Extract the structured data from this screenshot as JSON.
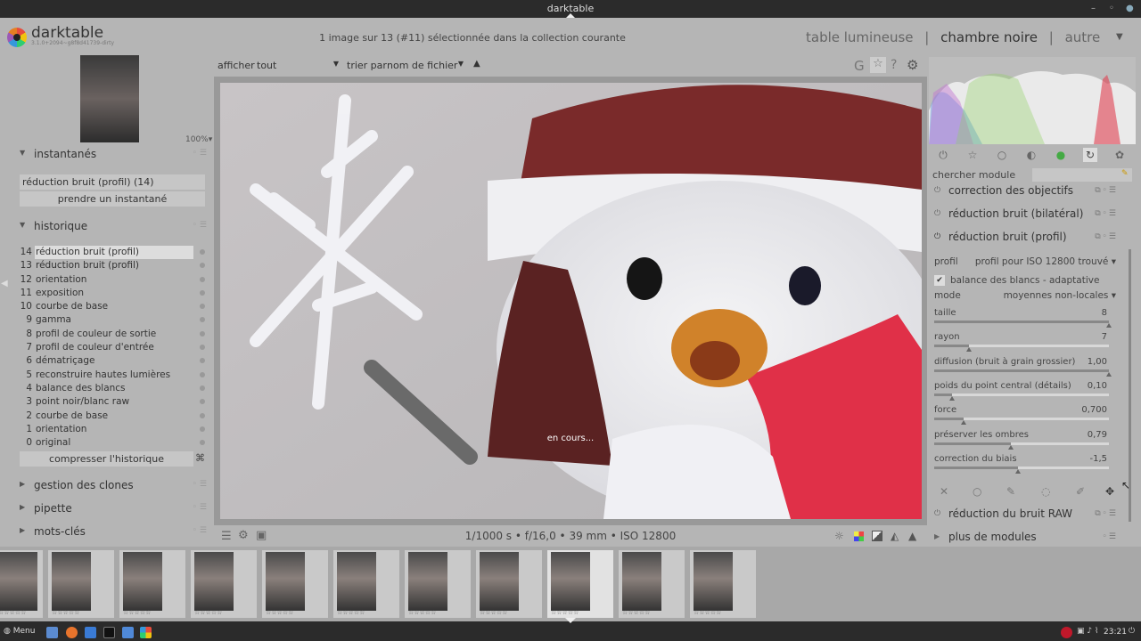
{
  "window": {
    "title": "darktable"
  },
  "header": {
    "app_name": "darktable",
    "version": "3.1.0+2094~g8f8d41739-dirty",
    "collection_info": "1 image sur 13 (#11) sélectionnée dans la collection courante",
    "views": [
      "table lumineuse",
      "chambre noire",
      "autre"
    ],
    "separator": "|",
    "active_view": "chambre noire"
  },
  "left": {
    "zoom": "100%",
    "snapshots": {
      "title": "instantanés",
      "item": "réduction bruit (profil) (14)",
      "take_button": "prendre un instantané"
    },
    "history": {
      "title": "historique",
      "items": [
        {
          "num": "14",
          "label": "réduction bruit (profil)"
        },
        {
          "num": "13",
          "label": "réduction bruit (profil)"
        },
        {
          "num": "12",
          "label": "orientation"
        },
        {
          "num": "11",
          "label": "exposition"
        },
        {
          "num": "10",
          "label": "courbe de base"
        },
        {
          "num": "9",
          "label": "gamma"
        },
        {
          "num": "8",
          "label": "profil de couleur de sortie"
        },
        {
          "num": "7",
          "label": "profil de couleur d'entrée"
        },
        {
          "num": "6",
          "label": "dématriçage"
        },
        {
          "num": "5",
          "label": "reconstruire hautes lumières"
        },
        {
          "num": "4",
          "label": "balance des blancs"
        },
        {
          "num": "3",
          "label": "point noir/blanc raw"
        },
        {
          "num": "2",
          "label": "courbe de base"
        },
        {
          "num": "1",
          "label": "orientation"
        },
        {
          "num": "0",
          "label": "original"
        }
      ],
      "compress_button": "compresser l'historique"
    },
    "sections": [
      "gestion des clones",
      "pipette",
      "mots-clés"
    ]
  },
  "center": {
    "show_label": "afficher",
    "show_value": "tout",
    "sort_label": "trier par",
    "sort_value": "nom de fichier",
    "status": "en cours...",
    "exif": "1/1000 s • f/16,0 • 39 mm • ISO 12800"
  },
  "right": {
    "search_label": "chercher module",
    "modules": [
      {
        "name": "correction des objectifs"
      },
      {
        "name": "réduction bruit (bilatéral)"
      },
      {
        "name": "réduction bruit (profil)"
      }
    ],
    "expanded": {
      "profile_label": "profil",
      "profile_value": "profil pour ISO 12800 trouvé",
      "wb_checkbox": "balance des blancs - adaptative",
      "mode_label": "mode",
      "mode_value": "moyennes non-locales",
      "params": [
        {
          "label": "taille",
          "value": "8",
          "fraction": 1.0
        },
        {
          "label": "rayon",
          "value": "7",
          "fraction": 0.2
        },
        {
          "label": "diffusion (bruit à grain grossier)",
          "value": "1,00",
          "fraction": 1.0
        },
        {
          "label": "poids du point central (détails)",
          "value": "0,10",
          "fraction": 0.1
        },
        {
          "label": "force",
          "value": "0,700",
          "fraction": 0.17
        },
        {
          "label": "préserver les ombres",
          "value": "0,79",
          "fraction": 0.44
        },
        {
          "label": "correction du biais",
          "value": "-1,5",
          "fraction": 0.48
        }
      ]
    },
    "raw_module": "réduction du bruit RAW",
    "more_modules": "plus de modules"
  },
  "taskbar": {
    "menu": "Menu",
    "clock": "23:21"
  }
}
